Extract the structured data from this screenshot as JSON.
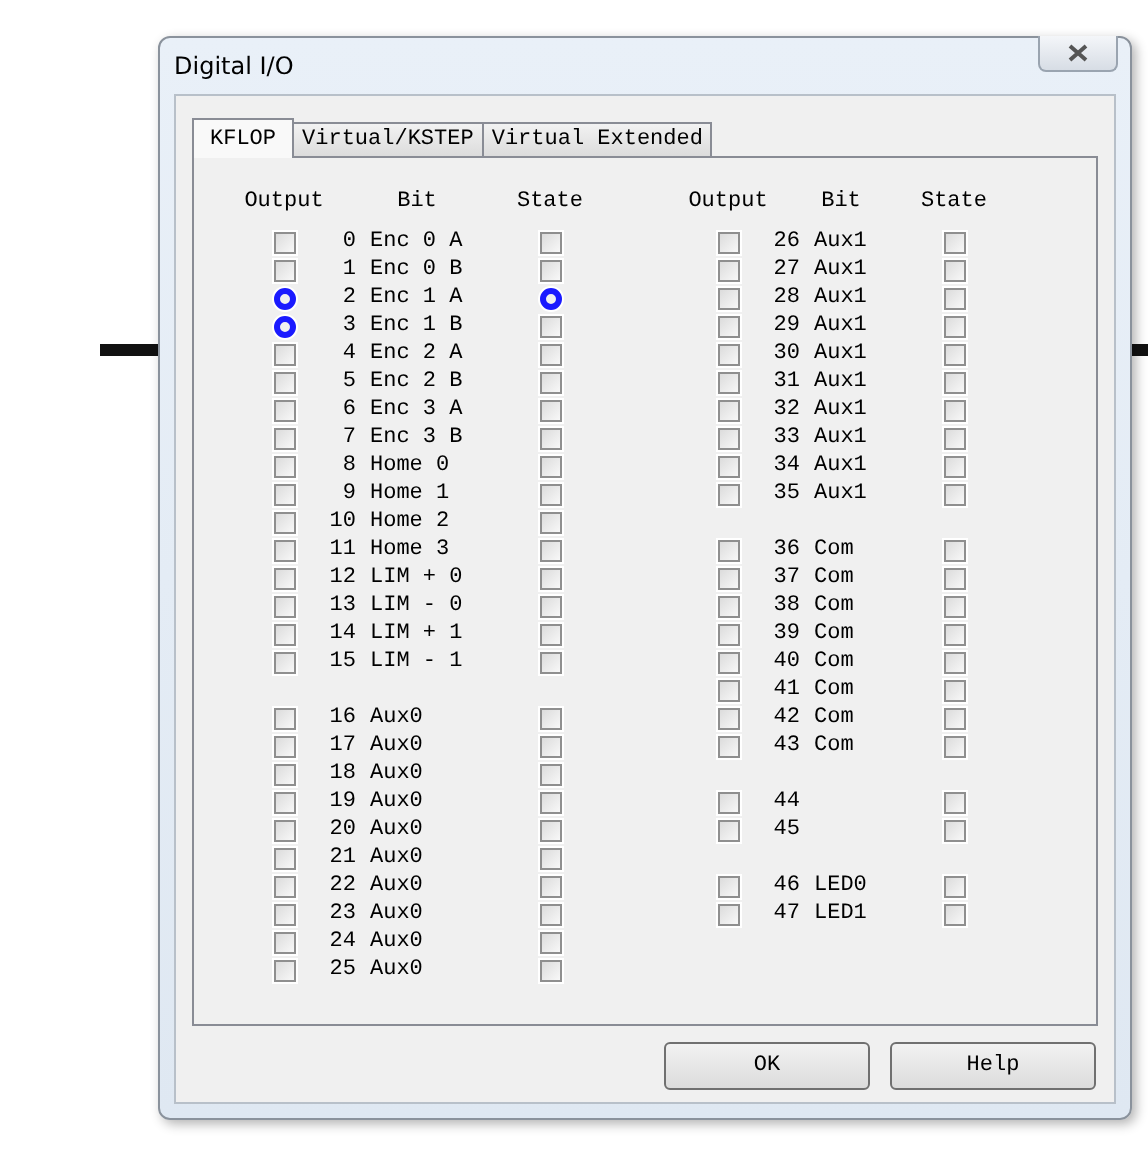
{
  "window": {
    "title": "Digital I/O"
  },
  "tabs": [
    {
      "label": "KFLOP",
      "selected": true
    },
    {
      "label": "Virtual/KSTEP",
      "selected": false
    },
    {
      "label": "Virtual Extended",
      "selected": false
    }
  ],
  "columns": [
    {
      "headers": [
        "Output",
        "Bit",
        "State"
      ],
      "groups": [
        [
          {
            "bit": "0",
            "name": "Enc 0 A",
            "output_marked": false,
            "state_marked": false
          },
          {
            "bit": "1",
            "name": "Enc 0 B",
            "output_marked": false,
            "state_marked": false
          },
          {
            "bit": "2",
            "name": "Enc 1 A",
            "output_marked": true,
            "state_marked": true
          },
          {
            "bit": "3",
            "name": "Enc 1 B",
            "output_marked": true,
            "state_marked": false
          },
          {
            "bit": "4",
            "name": "Enc 2 A",
            "output_marked": false,
            "state_marked": false
          },
          {
            "bit": "5",
            "name": "Enc 2 B",
            "output_marked": false,
            "state_marked": false
          },
          {
            "bit": "6",
            "name": "Enc 3 A",
            "output_marked": false,
            "state_marked": false
          },
          {
            "bit": "7",
            "name": "Enc 3 B",
            "output_marked": false,
            "state_marked": false
          },
          {
            "bit": "8",
            "name": "Home 0",
            "output_marked": false,
            "state_marked": false
          },
          {
            "bit": "9",
            "name": "Home 1",
            "output_marked": false,
            "state_marked": false
          },
          {
            "bit": "10",
            "name": "Home 2",
            "output_marked": false,
            "state_marked": false
          },
          {
            "bit": "11",
            "name": "Home 3",
            "output_marked": false,
            "state_marked": false
          },
          {
            "bit": "12",
            "name": "LIM + 0",
            "output_marked": false,
            "state_marked": false
          },
          {
            "bit": "13",
            "name": "LIM - 0",
            "output_marked": false,
            "state_marked": false
          },
          {
            "bit": "14",
            "name": "LIM + 1",
            "output_marked": false,
            "state_marked": false
          },
          {
            "bit": "15",
            "name": "LIM - 1",
            "output_marked": false,
            "state_marked": false
          }
        ],
        [
          {
            "bit": "16",
            "name": "Aux0",
            "output_marked": false,
            "state_marked": false
          },
          {
            "bit": "17",
            "name": "Aux0",
            "output_marked": false,
            "state_marked": false
          },
          {
            "bit": "18",
            "name": "Aux0",
            "output_marked": false,
            "state_marked": false
          },
          {
            "bit": "19",
            "name": "Aux0",
            "output_marked": false,
            "state_marked": false
          },
          {
            "bit": "20",
            "name": "Aux0",
            "output_marked": false,
            "state_marked": false
          },
          {
            "bit": "21",
            "name": "Aux0",
            "output_marked": false,
            "state_marked": false
          },
          {
            "bit": "22",
            "name": "Aux0",
            "output_marked": false,
            "state_marked": false
          },
          {
            "bit": "23",
            "name": "Aux0",
            "output_marked": false,
            "state_marked": false
          },
          {
            "bit": "24",
            "name": "Aux0",
            "output_marked": false,
            "state_marked": false
          },
          {
            "bit": "25",
            "name": "Aux0",
            "output_marked": false,
            "state_marked": false
          }
        ]
      ]
    },
    {
      "headers": [
        "Output",
        "Bit",
        "State"
      ],
      "groups": [
        [
          {
            "bit": "26",
            "name": "Aux1",
            "output_marked": false,
            "state_marked": false
          },
          {
            "bit": "27",
            "name": "Aux1",
            "output_marked": false,
            "state_marked": false
          },
          {
            "bit": "28",
            "name": "Aux1",
            "output_marked": false,
            "state_marked": false
          },
          {
            "bit": "29",
            "name": "Aux1",
            "output_marked": false,
            "state_marked": false
          },
          {
            "bit": "30",
            "name": "Aux1",
            "output_marked": false,
            "state_marked": false
          },
          {
            "bit": "31",
            "name": "Aux1",
            "output_marked": false,
            "state_marked": false
          },
          {
            "bit": "32",
            "name": "Aux1",
            "output_marked": false,
            "state_marked": false
          },
          {
            "bit": "33",
            "name": "Aux1",
            "output_marked": false,
            "state_marked": false
          },
          {
            "bit": "34",
            "name": "Aux1",
            "output_marked": false,
            "state_marked": false
          },
          {
            "bit": "35",
            "name": "Aux1",
            "output_marked": false,
            "state_marked": false
          }
        ],
        [
          {
            "bit": "36",
            "name": "Com",
            "output_marked": false,
            "state_marked": false
          },
          {
            "bit": "37",
            "name": "Com",
            "output_marked": false,
            "state_marked": false
          },
          {
            "bit": "38",
            "name": "Com",
            "output_marked": false,
            "state_marked": false
          },
          {
            "bit": "39",
            "name": "Com",
            "output_marked": false,
            "state_marked": false
          },
          {
            "bit": "40",
            "name": "Com",
            "output_marked": false,
            "state_marked": false
          },
          {
            "bit": "41",
            "name": "Com",
            "output_marked": false,
            "state_marked": false
          },
          {
            "bit": "42",
            "name": "Com",
            "output_marked": false,
            "state_marked": false
          },
          {
            "bit": "43",
            "name": "Com",
            "output_marked": false,
            "state_marked": false
          }
        ],
        [
          {
            "bit": "44",
            "output_marked": false,
            "state_marked": false
          },
          {
            "bit": "45",
            "output_marked": false,
            "state_marked": false
          }
        ],
        [
          {
            "bit": "46",
            "name": "LED0",
            "output_marked": false,
            "state_marked": false
          },
          {
            "bit": "47",
            "name": "LED1",
            "output_marked": false,
            "state_marked": false
          }
        ]
      ]
    }
  ],
  "buttons": [
    "OK",
    "Help"
  ]
}
